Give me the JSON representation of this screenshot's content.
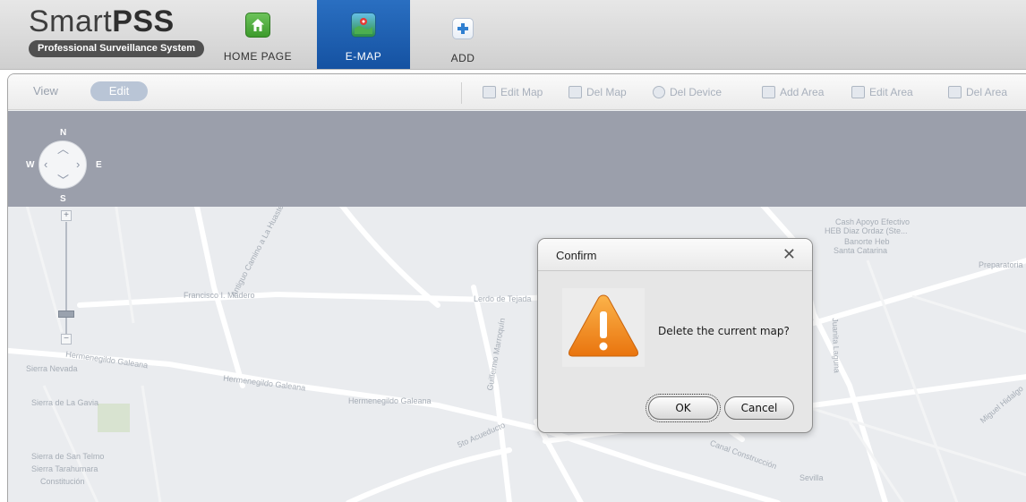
{
  "app": {
    "logo_prefix": "Smart",
    "logo_bold": "PSS",
    "tagline": "Professional Surveillance System"
  },
  "nav": {
    "tabs": [
      {
        "label": "HOME PAGE",
        "icon": "home-icon"
      },
      {
        "label": "E-MAP",
        "icon": "map-icon",
        "active": true
      },
      {
        "label": "ADD",
        "icon": "plus-icon"
      }
    ]
  },
  "toolbar": {
    "view_label": "View",
    "edit_label": "Edit",
    "tools": [
      {
        "label": "Edit Map",
        "icon": "edit-map-icon"
      },
      {
        "label": "Del Map",
        "icon": "delete-map-icon"
      },
      {
        "label": "Del Device",
        "icon": "delete-device-icon"
      },
      {
        "label": "Add Area",
        "icon": "add-area-icon"
      },
      {
        "label": "Edit Area",
        "icon": "edit-area-icon"
      },
      {
        "label": "Del Area",
        "icon": "delete-area-icon"
      }
    ]
  },
  "compass": {
    "n": "N",
    "s": "S",
    "e": "E",
    "w": "W"
  },
  "map_labels": {
    "l1": "Francisco I. Madero",
    "l2": "Lerdo de Tejada",
    "l3": "Hermenegildo Galeana",
    "l4": "Hermenegildo Galeana",
    "l5": "Hermenegildo Galeana",
    "l6": "Antiguo Camino a La Huasteca",
    "l7": "Sierra Nevada",
    "l8": "Sierra de La Gavia",
    "l9": "Sierra de San Telmo",
    "l10": "Sierra Tarahumara",
    "l11": "Constitución",
    "l12": "Cash Apoyo Efectivo",
    "l13": "HEB Diaz Ordaz (Ste...",
    "l14": "Banorte Heb",
    "l15": "Santa Catarina",
    "l16": "Canal Construcción",
    "l17": "Preparatoria",
    "l18": "Guillermo Marroquín",
    "l19": "Juanita Laguna",
    "l20": "Miguel Hidalgo",
    "l21": "5to Acueducto",
    "l22": "Sevilla"
  },
  "dialog": {
    "title": "Confirm",
    "close_symbol": "✕",
    "message": "Delete the current map?",
    "ok_label": "OK",
    "cancel_label": "Cancel"
  },
  "colors": {
    "active_tab": "#1d5fb0",
    "map_header": "#9b9fab",
    "map_bg": "#eaecef",
    "warning": "#f08a1c"
  }
}
